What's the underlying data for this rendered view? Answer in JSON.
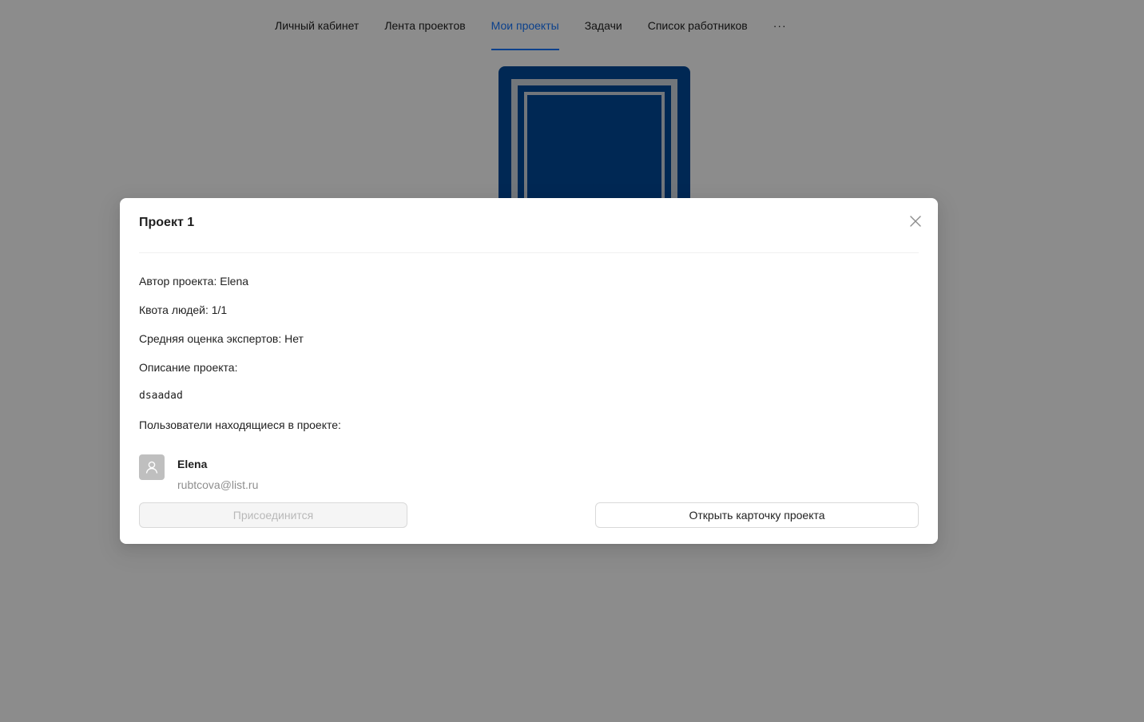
{
  "nav": {
    "items": [
      {
        "label": "Личный кабинет"
      },
      {
        "label": "Лента проектов"
      },
      {
        "label": "Мои проекты"
      },
      {
        "label": "Задачи"
      },
      {
        "label": "Список работников"
      },
      {
        "label": "···"
      }
    ],
    "active_index": 2
  },
  "colors": {
    "accent": "#1677ff",
    "sign_blue": "#004a99"
  },
  "modal": {
    "title": "Проект 1",
    "author": "Автор проекта: Elena",
    "quota": "Квота людей: 1/1",
    "rating": "Средняя оценка экспертов: Нет",
    "description_label": "Описание проекта:",
    "description": "dsaadad",
    "members_label": "Пользователи находящиеся в проекте:",
    "members": [
      {
        "name": "Elena",
        "email": "rubtcova@list.ru",
        "icon": "user-icon"
      }
    ],
    "join_button": "Присоединится",
    "open_card_button": "Открыть карточку проекта",
    "close_icon": "close-icon"
  }
}
